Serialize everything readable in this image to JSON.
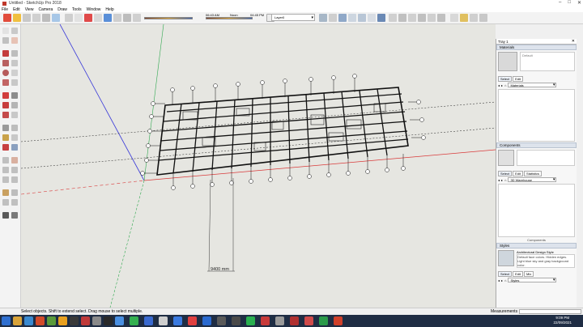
{
  "window": {
    "title": "Untitled - SketchUp Pro 2018",
    "controls": [
      "–",
      "□",
      "✕"
    ]
  },
  "menu": [
    "File",
    "Edit",
    "View",
    "Camera",
    "Draw",
    "Tools",
    "Window",
    "Help"
  ],
  "toolbar": {
    "shadow_time_label": "06:43 AM",
    "shadow_noon_label": "Noon",
    "shadow_end_label": "04:45 PM",
    "layer_value": "Layer0"
  },
  "viewport": {
    "dimension_label": "9400 mm"
  },
  "tray": {
    "title": "Tray 1",
    "materials": {
      "header": "Materials",
      "preview_label": "Default",
      "tabs": [
        "Select",
        "Edit"
      ],
      "library": "Materials"
    },
    "components": {
      "header": "Components",
      "tabs": [
        "Select",
        "Edit",
        "Statistics"
      ],
      "library": "3D Warehouse",
      "footer": "Components"
    },
    "styles": {
      "header": "Styles",
      "style_name": "Architectural Design Style",
      "style_desc": "Default face colors. Hidden edges. Light blue sky and gray background color.",
      "tabs": [
        "Select",
        "Edit",
        "Mix"
      ],
      "library": "Styles"
    }
  },
  "status": {
    "hint": "Select objects. Shift to extend select. Drag mouse to select multiple.",
    "measurements_label": "Measurements"
  },
  "taskbar": {
    "time": "9:09 PM",
    "date": "22/09/2021"
  },
  "colors": {
    "axis_red": "#d93a3a",
    "axis_green": "#2fa84f",
    "axis_blue": "#3a3ad9",
    "viewport_bg": "#e6e6e1",
    "taskbar_bg": "#1f2d44"
  }
}
